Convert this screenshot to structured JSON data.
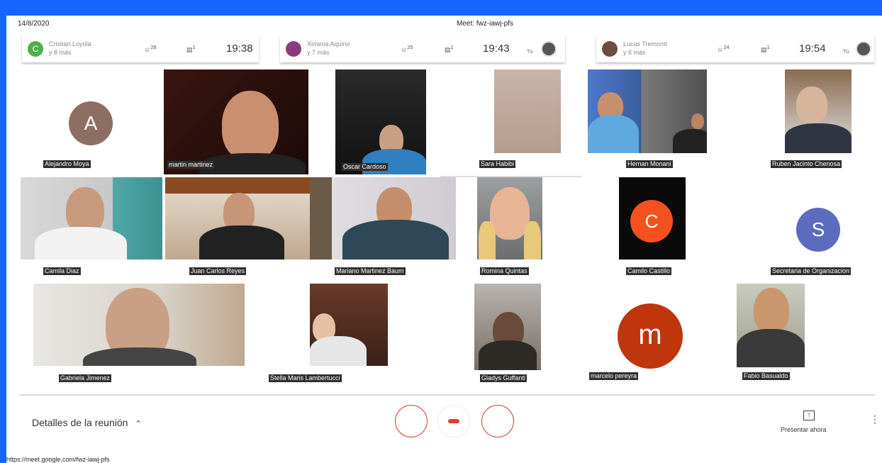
{
  "header": {
    "date": "14/8/2020",
    "meeting_title": "Meet: fwz-iawj-pfs"
  },
  "notification_strips": [
    {
      "initial": "C",
      "avatar_color": "#4caf50",
      "name": "Cristian Loyola",
      "subtitle": "y 8 más",
      "people_count": "28",
      "chat_count": "1",
      "time": "19:38"
    },
    {
      "initial": "",
      "avatar_color": "#8e3a7a",
      "name": "Ximena Aquino",
      "subtitle": "y 7 más",
      "people_count": "25",
      "chat_count": "1",
      "time": "19:43",
      "you_label": "Tú"
    },
    {
      "initial": "",
      "avatar_color": "#6d4c41",
      "name": "Lucas Tremonti",
      "subtitle": "y 6 más",
      "people_count": "24",
      "chat_count": "1",
      "time": "19:54",
      "you_label": "Tú"
    }
  ],
  "participants": [
    {
      "name": "Alejandro Moya"
    },
    {
      "name": "martin martinez"
    },
    {
      "name": "Oscar Cardoso"
    },
    {
      "name": "Sara Habibi"
    },
    {
      "name": "Hernan Monani"
    },
    {
      "name": "Ruben Jacinto Chenosa"
    },
    {
      "name": "Camila Diaz"
    },
    {
      "name": "Juan Carlos Reyes"
    },
    {
      "name": "Mariano Martinez Baum"
    },
    {
      "name": "Romina Quintas"
    },
    {
      "name": "Camilo Castillo"
    },
    {
      "name": "Secretaria de Organizacion"
    },
    {
      "name": "Gabriela Jimenez"
    },
    {
      "name": "Stella Maris Lambertucci"
    },
    {
      "name": "Gladys Guffanti"
    },
    {
      "name": "marcelo pereyra"
    },
    {
      "name": "Fabio Basualdo"
    }
  ],
  "avatars": {
    "alejandro": {
      "initial": "A",
      "color": "#8d6e63"
    },
    "camilo": {
      "initial": "C",
      "color": "#f4511e"
    },
    "secretaria": {
      "initial": "S",
      "color": "#5c6bc0"
    },
    "marcelo": {
      "initial": "m",
      "color": "#bf360c"
    }
  },
  "footer": {
    "details_label": "Detalles de la reunión",
    "present_label": "Presentar ahora",
    "more_icon": "⋮",
    "url": "https://meet.google.com/fwz-iawj-pfs"
  },
  "icons": {
    "people": "people-icon",
    "chat": "chat-icon",
    "hangup": "hangup-icon"
  }
}
